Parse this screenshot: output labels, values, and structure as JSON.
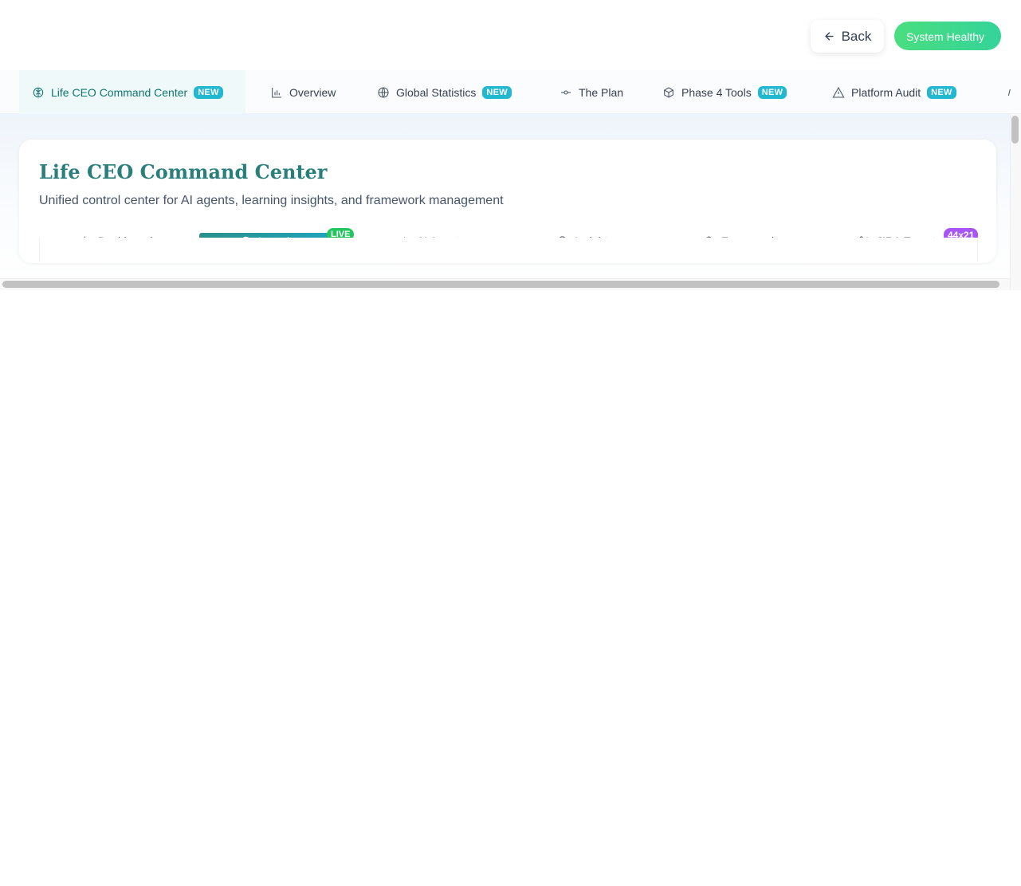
{
  "header": {
    "back_label": "Back",
    "status_label": "System Healthy"
  },
  "nav": {
    "items": [
      {
        "label": "Life CEO Command Center",
        "badge": "NEW",
        "icon": "brain-icon",
        "active": true
      },
      {
        "label": "Overview",
        "icon": "bar-chart-icon"
      },
      {
        "label": "Global Statistics",
        "badge": "NEW",
        "icon": "globe-icon"
      },
      {
        "label": "The Plan",
        "icon": "git-commit-icon"
      },
      {
        "label": "Phase 4 Tools",
        "badge": "NEW",
        "icon": "package-icon"
      },
      {
        "label": "Platform Audit",
        "badge": "NEW",
        "icon": "alert-triangle-icon"
      }
    ]
  },
  "card": {
    "title": "Life CEO Command Center",
    "subtitle": "Unified control center for AI agents, learning insights, and framework management",
    "tabs": [
      {
        "label": "Dashboard",
        "icon": "activity-icon"
      },
      {
        "label": "Learnings",
        "icon": "brain-icon",
        "active": true,
        "badge": "LIVE"
      },
      {
        "label": "AI Agent",
        "icon": "bot-icon"
      },
      {
        "label": "Insights",
        "icon": "lightbulb-icon"
      },
      {
        "label": "Framework",
        "icon": "layers-icon"
      },
      {
        "label": "JIRA Export",
        "icon": "git-branch-icon",
        "badge": "44x21"
      }
    ]
  },
  "colors": {
    "accent": "#2a7f7c",
    "badge_new": "#22b8cf",
    "badge_live": "#22c55e",
    "badge_count": "#a855f7",
    "status_green": "#34d399"
  }
}
